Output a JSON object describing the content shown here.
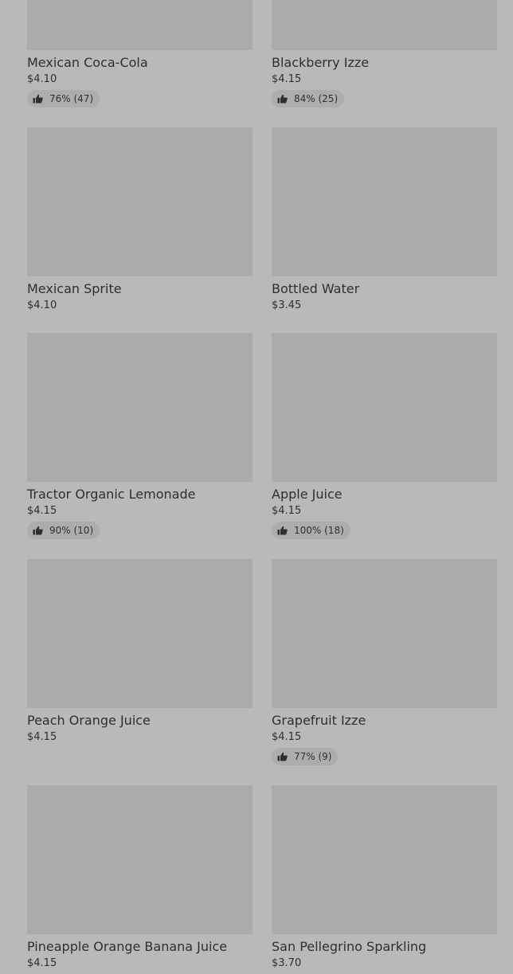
{
  "colors": {
    "background": "#b9b9b9",
    "image_placeholder": "#ababab",
    "rating_pill": "#adadad",
    "text": "#2f2f2f"
  },
  "items": [
    {
      "name": "Mexican Coca-Cola",
      "price": "$4.10",
      "rating": "76% (47)",
      "icon": "thumbs-up-icon"
    },
    {
      "name": "Blackberry Izze",
      "price": "$4.15",
      "rating": "84% (25)",
      "icon": "thumbs-up-icon"
    },
    {
      "name": "Mexican Sprite",
      "price": "$4.10",
      "rating": null
    },
    {
      "name": "Bottled Water",
      "price": "$3.45",
      "rating": null
    },
    {
      "name": "Tractor Organic Lemonade",
      "price": "$4.15",
      "rating": "90% (10)",
      "icon": "thumbs-up-icon"
    },
    {
      "name": "Apple Juice",
      "price": "$4.15",
      "rating": "100% (18)",
      "icon": "thumbs-up-icon"
    },
    {
      "name": "Peach Orange Juice",
      "price": "$4.15",
      "rating": null
    },
    {
      "name": "Grapefruit Izze",
      "price": "$4.15",
      "rating": "77% (9)",
      "icon": "thumbs-up-icon"
    },
    {
      "name": "Pineapple Orange Banana Juice",
      "price": "$4.15",
      "rating": null
    },
    {
      "name": "San Pellegrino Sparkling",
      "price": "$3.70",
      "rating": null
    }
  ]
}
